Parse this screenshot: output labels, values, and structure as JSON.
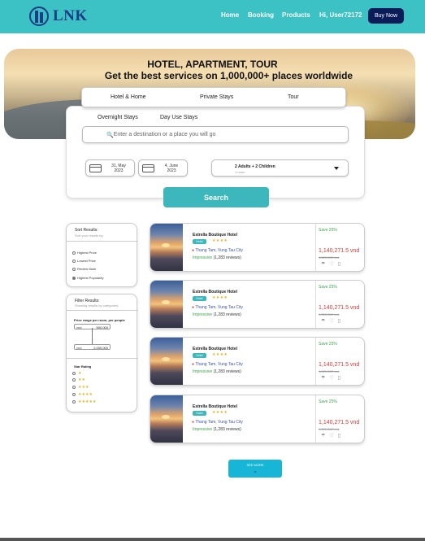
{
  "header": {
    "logo_text": "LNK",
    "nav": [
      "Home",
      "Booking",
      "Products",
      "Hi, User72172"
    ],
    "buy_button": "Buy Now"
  },
  "hero": {
    "title": "HOTEL, APARTMENT, TOUR",
    "subtitle": "Get the best services on  1,000,000+ places worldwide"
  },
  "search": {
    "tabs": [
      "Hotel & Home",
      "Private Stays",
      "Tour"
    ],
    "subtabs": [
      "Overnight Stays",
      "Day Use Stays"
    ],
    "destination_placeholder": "Enter a destination or a place you will go",
    "checkin": {
      "day": "31, May",
      "year": "2023"
    },
    "checkout": {
      "day": "4, June",
      "year": "2023"
    },
    "guests": "2 Adults + 2 Children",
    "rooms": "1 room",
    "button": "Search"
  },
  "sort": {
    "title": "Sort Results:",
    "subtitle": "Sort your results by:",
    "options": [
      "Highest Price",
      "Lowest Price",
      "Review Mark",
      "Highest Popularity"
    ],
    "selected_index": 3
  },
  "filter": {
    "title": "Filter Results:",
    "subtitle": "Showing results by categories:",
    "price_label": "Price range per room, per people",
    "currency": "vnd",
    "max_value": "500.000",
    "min_value": "2.000.000",
    "star_title": "Star Rating",
    "star_options": [
      "★",
      "★★",
      "★★★",
      "★★★★",
      "★★★★★"
    ]
  },
  "hotels": [
    {
      "name": "Estrella Boutique Hotel",
      "tag": "Hotel",
      "stars": "★★★★",
      "location": "Thang Tam, Vung Tau City",
      "rating_word": "Impressive",
      "reviews": "(1,283 reviews)",
      "save": "Save 25%",
      "price": "1,140,271.5 vnd",
      "old_price": "1,520,362 vnd"
    },
    {
      "name": "Estrella Boutique Hotel",
      "tag": "Hotel",
      "stars": "★★★★",
      "location": "Thang Tam, Vung Tau City",
      "rating_word": "Impressive",
      "reviews": "(1,283 reviews)",
      "save": "Save 25%",
      "price": "1,140,271.5 vnd",
      "old_price": "1,520,362 vnd"
    },
    {
      "name": "Estrella Boutique Hotel",
      "tag": "Hotel",
      "stars": "★★★★",
      "location": "Thang Tam, Vung Tau City",
      "rating_word": "Impressive",
      "reviews": "(1,283 reviews)",
      "save": "Save 25%",
      "price": "1,140,271.5 vnd",
      "old_price": "1,520,362 vnd"
    },
    {
      "name": "Estrella Boutique Hotel",
      "tag": "Hotel",
      "stars": "★★★★",
      "location": "Thang Tam, Vung Tau City",
      "rating_word": "Impressive",
      "reviews": "(1,283 reviews)",
      "save": "Save 25%",
      "price": "1,140,271.5 vnd",
      "old_price": "1,520,362 vnd"
    }
  ],
  "see_more": "SEE MORE",
  "colors": {
    "brand_teal": "#3cc1c4",
    "navy": "#0b1c5a",
    "price_red": "#e03434",
    "save_green": "#3aa64a"
  }
}
